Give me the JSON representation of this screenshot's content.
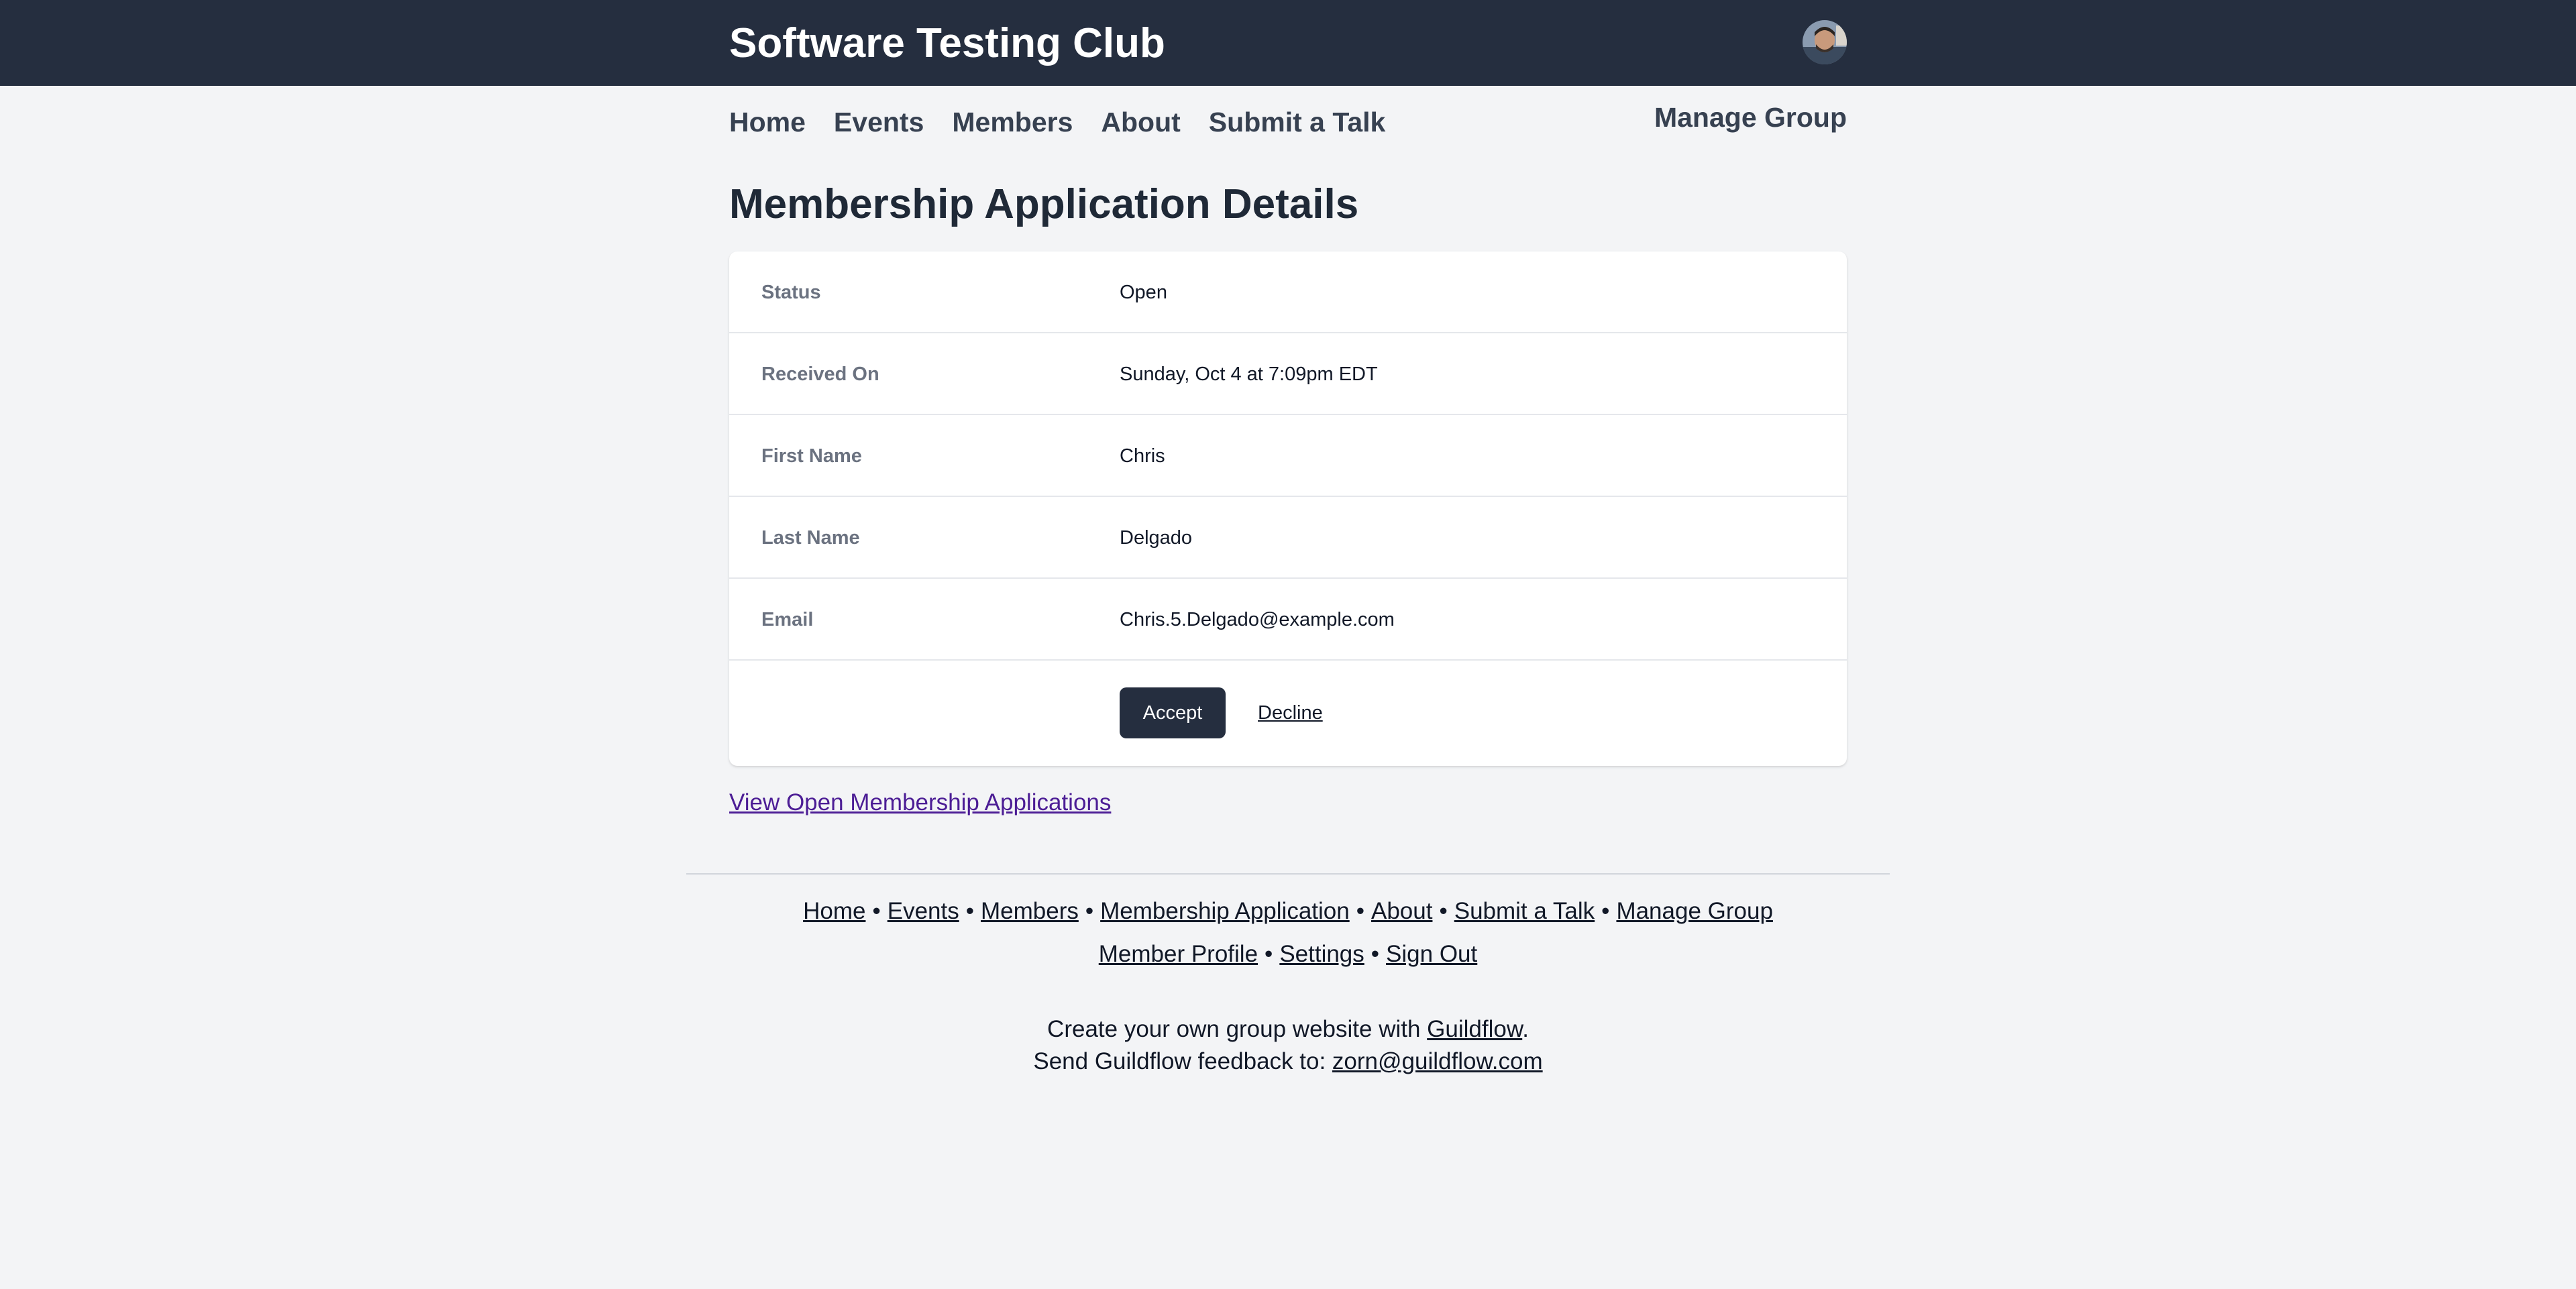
{
  "header": {
    "site_title": "Software Testing Club",
    "avatar_icon": "user-avatar-photo"
  },
  "nav": {
    "items": [
      {
        "label": "Home"
      },
      {
        "label": "Events"
      },
      {
        "label": "Members"
      },
      {
        "label": "About"
      },
      {
        "label": "Submit a Talk"
      }
    ],
    "manage_group": "Manage Group"
  },
  "page": {
    "title": "Membership Application Details"
  },
  "details": {
    "rows": [
      {
        "label": "Status",
        "value": "Open"
      },
      {
        "label": "Received On",
        "value": "Sunday, Oct 4 at 7:09pm EDT"
      },
      {
        "label": "First Name",
        "value": "Chris"
      },
      {
        "label": "Last Name",
        "value": "Delgado"
      },
      {
        "label": "Email",
        "value": "Chris.5.Delgado@example.com"
      }
    ],
    "accept_label": "Accept",
    "decline_label": "Decline"
  },
  "view_open_link": "View Open Membership Applications",
  "footer": {
    "links_row1": [
      "Home",
      "Events",
      "Members",
      "Membership Application",
      "About",
      "Submit a Talk",
      "Manage Group"
    ],
    "links_row2": [
      "Member Profile",
      "Settings",
      "Sign Out"
    ],
    "separator": "•",
    "create_prefix": "Create your own group website with ",
    "create_link": "Guildflow",
    "create_suffix": ".",
    "feedback_prefix": "Send Guildflow feedback to: ",
    "feedback_email": "zorn@guildflow.com"
  },
  "colors": {
    "header_bg": "#252e3f",
    "page_bg": "#f3f4f6",
    "link_purple": "#4c1d95"
  }
}
